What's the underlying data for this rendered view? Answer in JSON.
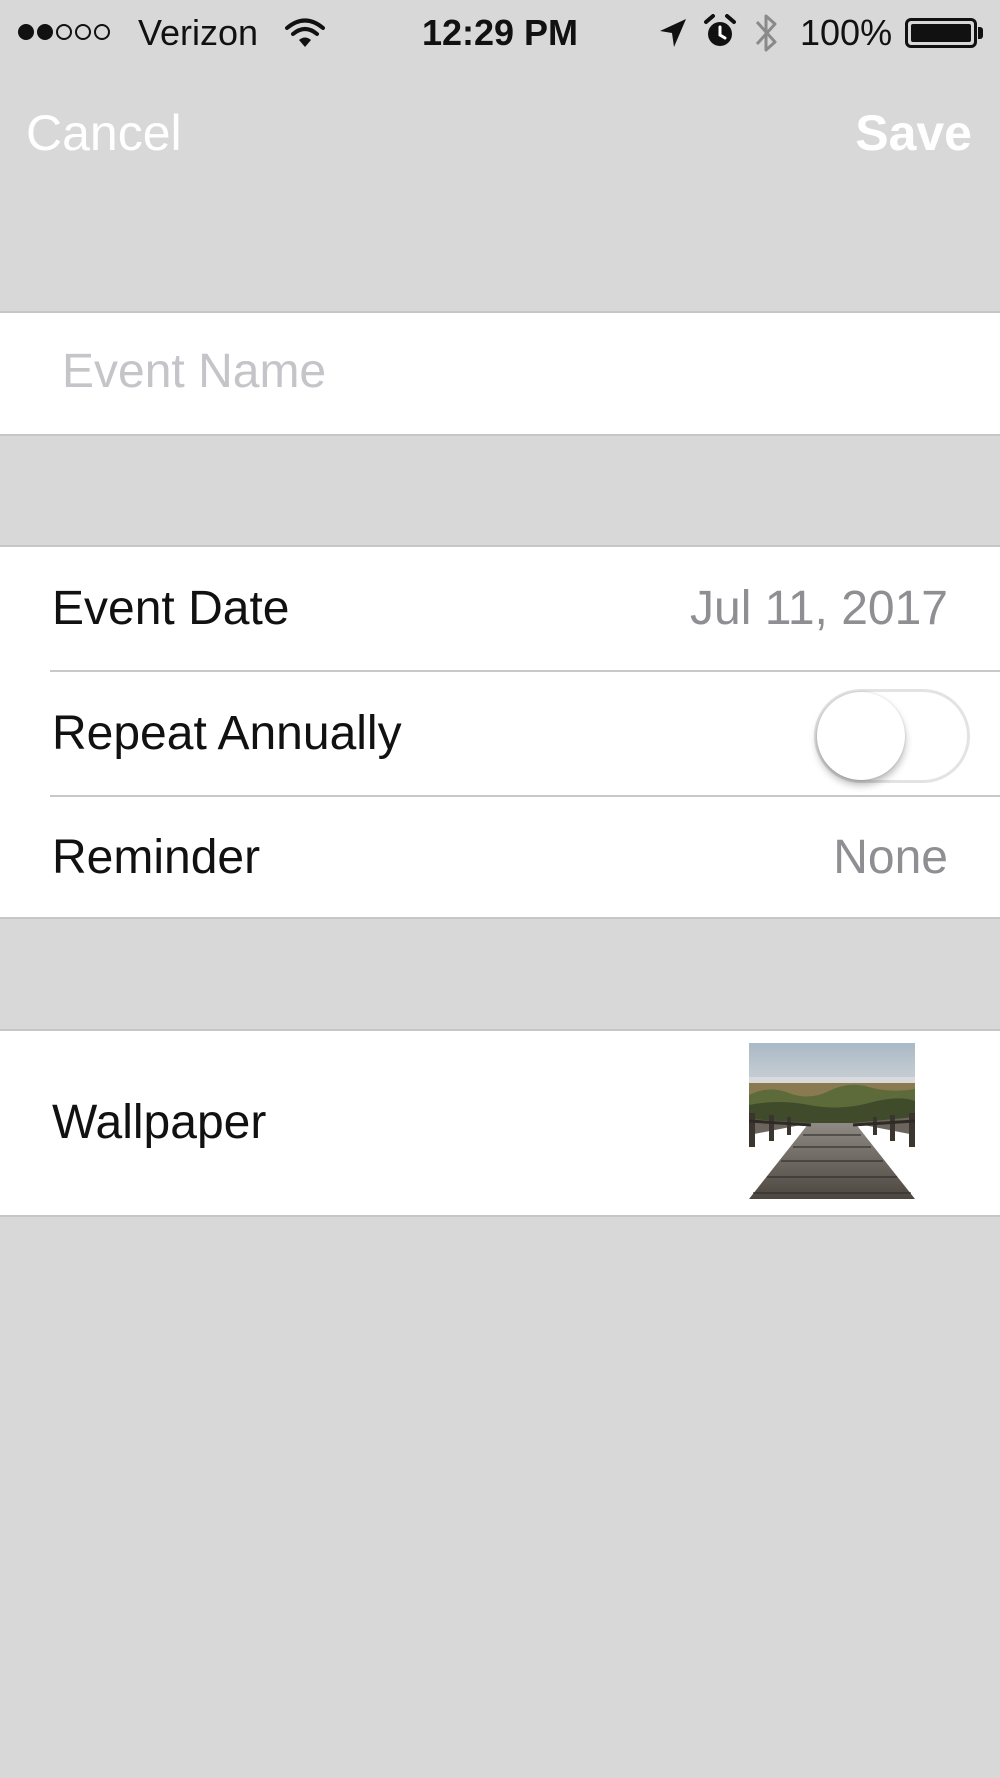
{
  "status_bar": {
    "carrier": "Verizon",
    "time": "12:29 PM",
    "battery_percent": "100%",
    "signal_bars_filled": 2,
    "signal_bars_total": 5
  },
  "nav": {
    "cancel_label": "Cancel",
    "save_label": "Save"
  },
  "form": {
    "event_name_placeholder": "Event Name",
    "event_name_value": "",
    "event_date_label": "Event Date",
    "event_date_value": "Jul 11, 2017",
    "repeat_label": "Repeat Annually",
    "repeat_on": false,
    "reminder_label": "Reminder",
    "reminder_value": "None",
    "wallpaper_label": "Wallpaper"
  },
  "icons": {
    "wifi": "wifi-icon",
    "location": "location-arrow-icon",
    "alarm": "alarm-clock-icon",
    "bluetooth": "bluetooth-icon",
    "battery": "battery-icon"
  },
  "colors": {
    "background": "#d8d8d8",
    "nav_text": "#ffffff",
    "secondary_text": "#8e8e93",
    "placeholder": "#c4c4c9"
  }
}
